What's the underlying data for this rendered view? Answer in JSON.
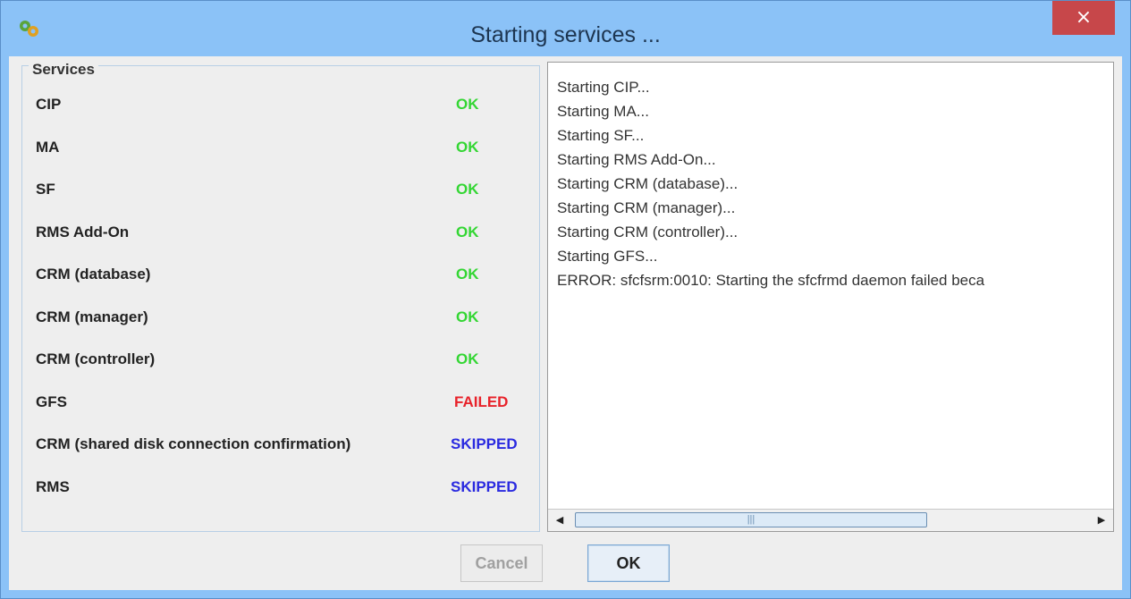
{
  "window": {
    "title": "Starting services ...",
    "close_glyph": "×"
  },
  "services": {
    "legend": "Services",
    "items": [
      {
        "name": "CIP",
        "status": "OK",
        "status_color": "#33d633"
      },
      {
        "name": "MA",
        "status": "OK",
        "status_color": "#33d633"
      },
      {
        "name": "SF",
        "status": "OK",
        "status_color": "#33d633"
      },
      {
        "name": "RMS Add-On",
        "status": "OK",
        "status_color": "#33d633"
      },
      {
        "name": "CRM (database)",
        "status": "OK",
        "status_color": "#33d633"
      },
      {
        "name": "CRM (manager)",
        "status": "OK",
        "status_color": "#33d633"
      },
      {
        "name": "CRM (controller)",
        "status": "OK",
        "status_color": "#33d633"
      },
      {
        "name": "GFS",
        "status": "FAILED",
        "status_color": "#e8222a"
      },
      {
        "name": "CRM (shared disk connection confirmation)",
        "status": "SKIPPED",
        "status_color": "#2a2ae0"
      },
      {
        "name": "RMS",
        "status": "SKIPPED",
        "status_color": "#2a2ae0"
      }
    ]
  },
  "log": {
    "lines": [
      "Starting CIP...",
      "Starting MA...",
      "Starting SF...",
      "Starting RMS Add-On...",
      "Starting CRM (database)...",
      "Starting CRM (manager)...",
      "Starting CRM (controller)...",
      "Starting GFS...",
      "ERROR: sfcfsrm:0010: Starting the sfcfrmd daemon failed beca"
    ],
    "scroll_left_glyph": "◀",
    "scroll_right_glyph": "▶",
    "scroll_grip_glyph": "|||"
  },
  "buttons": {
    "cancel": "Cancel",
    "ok": "OK"
  },
  "icons": {
    "app": "app-gear-icon",
    "close": "close-icon"
  }
}
